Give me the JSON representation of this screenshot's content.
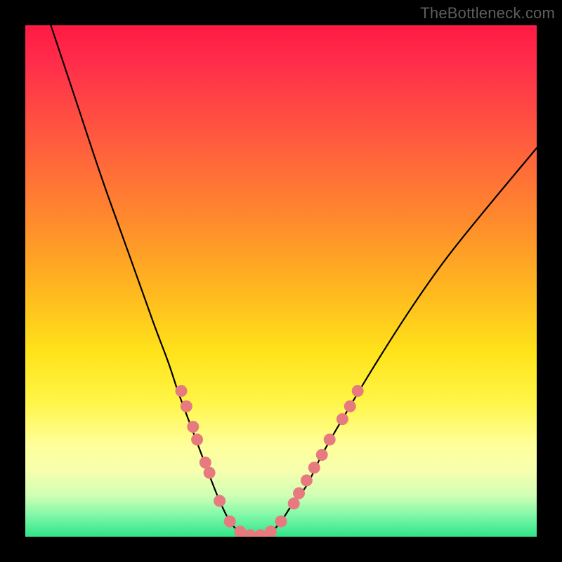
{
  "watermark": "TheBottleneck.com",
  "colors": {
    "dot": "#e77a7f",
    "curve": "#000000",
    "background_black": "#000000"
  },
  "chart_data": {
    "type": "line",
    "title": "",
    "xlabel": "",
    "ylabel": "",
    "xlim": [
      0,
      100
    ],
    "ylim": [
      0,
      100
    ],
    "grid": false,
    "series": [
      {
        "name": "bottleneck-curve",
        "description": "V-shaped bottleneck curve; y ≈ 100 at edges, y ≈ 0 near x ≈ 45",
        "x": [
          5,
          10,
          15,
          20,
          25,
          28,
          30,
          33,
          36,
          38,
          40,
          42,
          45,
          48,
          50,
          52,
          55,
          58,
          62,
          68,
          75,
          82,
          90,
          100
        ],
        "y": [
          100,
          85,
          70,
          56,
          42,
          34,
          28,
          20,
          12,
          7,
          3,
          1,
          0,
          1,
          3,
          6,
          10,
          16,
          23,
          33,
          44,
          54,
          64,
          76
        ]
      }
    ],
    "points": {
      "name": "highlighted-dots",
      "description": "Pink circular markers clustered on both flanks of the valley and along the trough",
      "coords": [
        {
          "x": 30.5,
          "y": 28.5
        },
        {
          "x": 31.5,
          "y": 25.5
        },
        {
          "x": 32.8,
          "y": 21.5
        },
        {
          "x": 33.6,
          "y": 19.0
        },
        {
          "x": 35.2,
          "y": 14.5
        },
        {
          "x": 36.0,
          "y": 12.5
        },
        {
          "x": 38.0,
          "y": 7.0
        },
        {
          "x": 40.0,
          "y": 3.0
        },
        {
          "x": 42.0,
          "y": 1.0
        },
        {
          "x": 44.0,
          "y": 0.3
        },
        {
          "x": 46.0,
          "y": 0.3
        },
        {
          "x": 48.0,
          "y": 1.0
        },
        {
          "x": 50.0,
          "y": 3.0
        },
        {
          "x": 52.5,
          "y": 6.5
        },
        {
          "x": 53.5,
          "y": 8.5
        },
        {
          "x": 55.0,
          "y": 11.0
        },
        {
          "x": 56.5,
          "y": 13.5
        },
        {
          "x": 58.0,
          "y": 16.0
        },
        {
          "x": 59.5,
          "y": 19.0
        },
        {
          "x": 62.0,
          "y": 23.0
        },
        {
          "x": 63.5,
          "y": 25.5
        },
        {
          "x": 65.0,
          "y": 28.5
        }
      ]
    }
  }
}
